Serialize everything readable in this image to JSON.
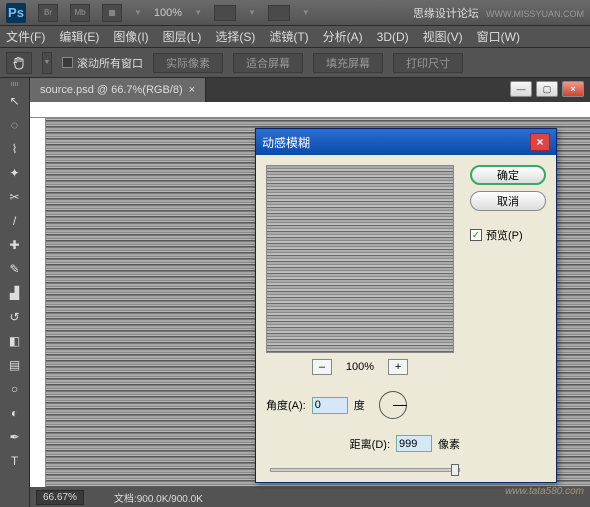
{
  "topbar": {
    "zoom": "100%",
    "brand": "思缘设计论坛",
    "url": "WWW.MISSYUAN.COM"
  },
  "menu": {
    "file": "文件(F)",
    "edit": "编辑(E)",
    "image": "图像(I)",
    "layer": "图层(L)",
    "select": "选择(S)",
    "filter": "滤镜(T)",
    "analysis": "分析(A)",
    "threeD": "3D(D)",
    "view": "视图(V)",
    "window": "窗口(W)"
  },
  "options": {
    "scroll_all": "滚动所有窗口",
    "actual_pixels": "实际像素",
    "fit_screen": "适合屏幕",
    "fill_screen": "填充屏幕",
    "print_size": "打印尺寸"
  },
  "doc": {
    "tab": "source.psd @ 66.7%(RGB/8)",
    "close_hint": "×"
  },
  "status": {
    "zoom": "66.67%",
    "docinfo": "文档:900.0K/900.0K"
  },
  "dialog": {
    "title": "动感模糊",
    "ok": "确定",
    "cancel": "取消",
    "preview_label": "预览(P)",
    "zoom": "100%",
    "angle_label": "角度(A):",
    "angle_value": "0",
    "angle_unit": "度",
    "dist_label": "距离(D):",
    "dist_value": "999",
    "dist_unit": "像素"
  },
  "watermark": "www.tata580.com"
}
